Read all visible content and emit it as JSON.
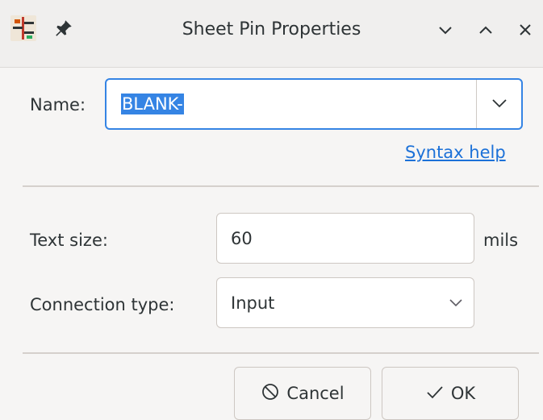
{
  "window": {
    "title": "Sheet Pin Properties",
    "controls": [
      "minimize",
      "maximize",
      "close"
    ]
  },
  "name_field": {
    "label": "Name:",
    "value": "BLANK-",
    "value_selected": true
  },
  "syntax_help": {
    "label": "Syntax help"
  },
  "text_size": {
    "label": "Text size:",
    "value": "60",
    "unit": "mils"
  },
  "connection_type": {
    "label": "Connection type:",
    "selected": "Input"
  },
  "buttons": {
    "cancel": "Cancel",
    "ok": "OK"
  },
  "colors": {
    "accent": "#3584e4",
    "link": "#1c71d8",
    "background": "#f6f5f4"
  },
  "icons": [
    "kicad-sheet-pin-icon",
    "pin-icon",
    "minimize-icon",
    "maximize-icon",
    "close-icon",
    "chevron-down-icon",
    "cancel-icon",
    "checkmark-icon"
  ]
}
